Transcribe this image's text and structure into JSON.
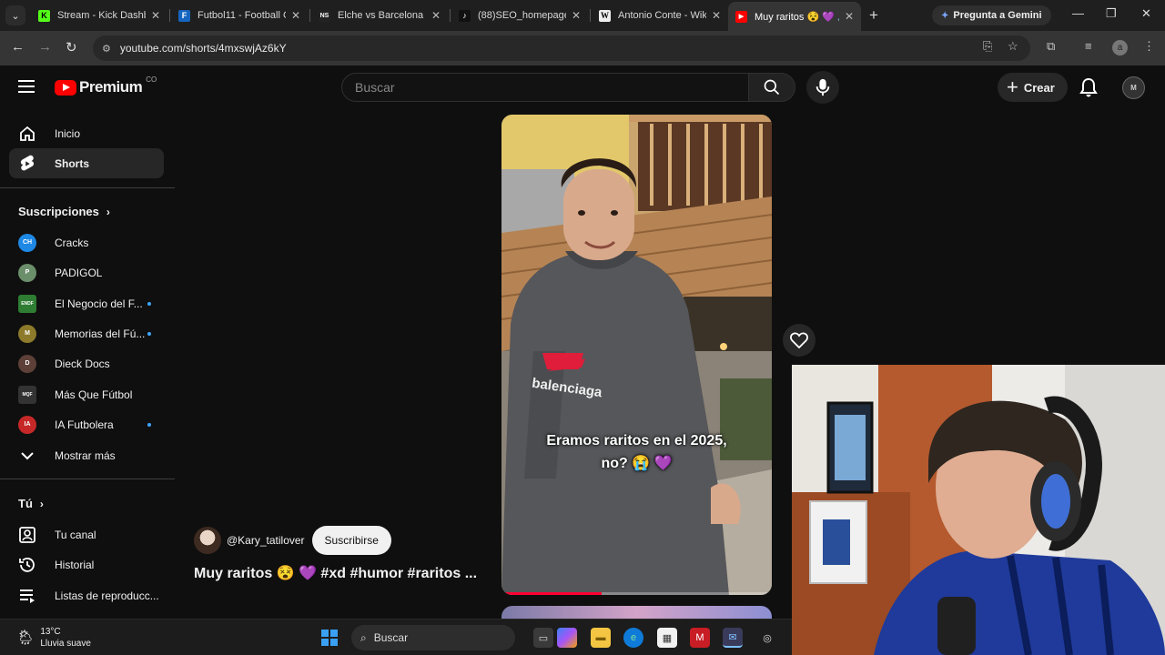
{
  "browser": {
    "tabs": [
      {
        "title": "Stream - Kick Dashb",
        "favicon": "kick-icon",
        "active": false
      },
      {
        "title": "Futbol11 - Football G",
        "favicon": "futbol11-icon",
        "active": false
      },
      {
        "title": "Elche vs Barcelona - ",
        "favicon": "news-icon",
        "active": false
      },
      {
        "title": "(88)SEO_homepage_",
        "favicon": "tiktok-icon",
        "active": false
      },
      {
        "title": "Antonio Conte - Wiki",
        "favicon": "wikipedia-icon",
        "active": false
      },
      {
        "title": "Muy raritos 😵 💜 🔊",
        "favicon": "youtube-icon",
        "active": true
      }
    ],
    "gemini_label": "Pregunta a Gemini",
    "url": "youtube.com/shorts/4mxswjAz6kY",
    "profile_initial": "a"
  },
  "youtube": {
    "logo_text": "Premium",
    "country_code": "CO",
    "search_placeholder": "Buscar",
    "create_label": "Crear",
    "avatar_text": "M"
  },
  "sidebar": {
    "main": [
      {
        "label": "Inicio",
        "icon": "home-icon",
        "active": false
      },
      {
        "label": "Shorts",
        "icon": "shorts-icon",
        "active": true
      }
    ],
    "subscriptions_heading": "Suscripciones",
    "subscriptions": [
      {
        "label": "Cracks",
        "avatar": "CH",
        "color": "#1e88e5",
        "new": false
      },
      {
        "label": "PADIGOL",
        "avatar": "P",
        "color": "#6b8e6b",
        "new": false
      },
      {
        "label": "El Negocio del F...",
        "avatar": "ENDF",
        "color": "#2e7d32",
        "new": true
      },
      {
        "label": "Memorias del Fú...",
        "avatar": "M",
        "color": "#8d7a2a",
        "new": true
      },
      {
        "label": "Dieck Docs",
        "avatar": "D",
        "color": "#5d4037",
        "new": false
      },
      {
        "label": "Más Que Fútbol",
        "avatar": "MQF",
        "color": "#333333",
        "new": false
      },
      {
        "label": "IA Futbolera",
        "avatar": "IA",
        "color": "#c62828",
        "new": true
      }
    ],
    "show_more": "Mostrar más",
    "you_heading": "Tú",
    "you_items": [
      {
        "label": "Tu canal",
        "icon": "channel-icon"
      },
      {
        "label": "Historial",
        "icon": "history-icon"
      },
      {
        "label": "Listas de reproducc...",
        "icon": "playlist-icon"
      }
    ]
  },
  "short": {
    "caption_line1": "Eramos raritos en el 2025,",
    "caption_line2": "no? 😭 💜",
    "author": "@Kary_tatilover",
    "subscribe_label": "Suscribirse",
    "title": "Muy raritos 😵 💜 #xd #humor #raritos ...",
    "progress": 0.37
  },
  "taskbar": {
    "temperature": "13°C",
    "weather": "Lluvia suave",
    "search_placeholder": "Buscar"
  }
}
